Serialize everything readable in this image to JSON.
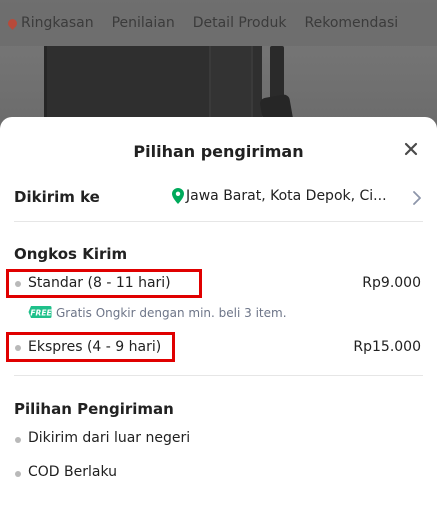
{
  "background_tabs": {
    "items": [
      "Ringkasan",
      "Penilaian",
      "Detail Produk",
      "Rekomendasi"
    ]
  },
  "sheet": {
    "title": "Pilihan pengiriman",
    "close_icon": "close-icon",
    "destination": {
      "label": "Dikirim ke",
      "value": "Jawa Barat,  Kota Depok,  Ci..."
    },
    "shipping_cost": {
      "title": "Ongkos Kirim",
      "options": [
        {
          "label": "Standar (8 - 11 hari)",
          "price": "Rp9.000"
        },
        {
          "label": "Ekspres (4 - 9 hari)",
          "price": "Rp15.000"
        }
      ],
      "promo": {
        "badge": "FREE",
        "text": "Gratis Ongkir dengan min. beli 3 item."
      }
    },
    "delivery_options": {
      "title": "Pilihan Pengiriman",
      "items": [
        "Dikirim dari luar negeri",
        "COD Berlaku"
      ]
    }
  },
  "colors": {
    "accent_green": "#03ac0e",
    "highlight_red": "#e00000",
    "location_teal": "#00aa5b"
  }
}
